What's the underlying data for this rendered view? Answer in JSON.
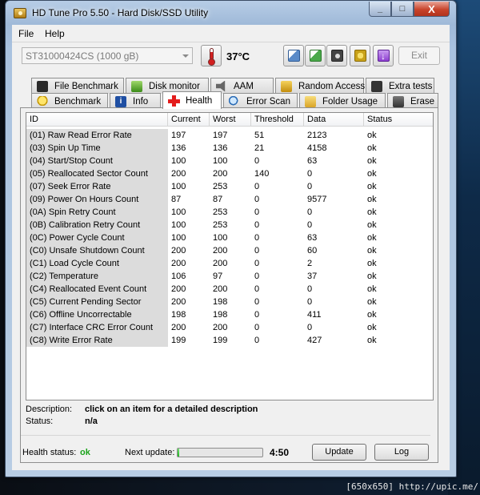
{
  "window": {
    "title": "HD Tune Pro 5.50 - Hard Disk/SSD Utility",
    "caption_buttons": [
      "_",
      "□",
      "X"
    ]
  },
  "menu": {
    "file": "File",
    "help": "Help"
  },
  "toolbar": {
    "drive": "ST31000424CS (1000 gB)",
    "temperature": "37°C",
    "exit_label": "Exit",
    "icons": [
      "copy-text-icon",
      "copy-screenshot-icon",
      "camera-icon",
      "options-icon",
      "save-download-icon"
    ]
  },
  "tabs": {
    "row1": [
      {
        "label": "File Benchmark",
        "icon": "file-benchmark-icon"
      },
      {
        "label": "Disk monitor",
        "icon": "disk-monitor-icon"
      },
      {
        "label": "AAM",
        "icon": "speaker-icon"
      },
      {
        "label": "Random Access",
        "icon": "random-access-icon"
      },
      {
        "label": "Extra tests",
        "icon": "extra-tests-icon"
      }
    ],
    "row2": [
      {
        "label": "Benchmark",
        "icon": "lightbulb-icon"
      },
      {
        "label": "Info",
        "icon": "info-icon"
      },
      {
        "label": "Health",
        "icon": "health-cross-icon",
        "active": true
      },
      {
        "label": "Error Scan",
        "icon": "magnifier-icon"
      },
      {
        "label": "Folder Usage",
        "icon": "folder-icon"
      },
      {
        "label": "Erase",
        "icon": "trash-icon"
      }
    ]
  },
  "table": {
    "headers": [
      "ID",
      "Current",
      "Worst",
      "Threshold",
      "Data",
      "Status"
    ],
    "rows": [
      [
        "(01) Raw Read Error Rate",
        "197",
        "197",
        "51",
        "2123",
        "ok"
      ],
      [
        "(03) Spin Up Time",
        "136",
        "136",
        "21",
        "4158",
        "ok"
      ],
      [
        "(04) Start/Stop Count",
        "100",
        "100",
        "0",
        "63",
        "ok"
      ],
      [
        "(05) Reallocated Sector Count",
        "200",
        "200",
        "140",
        "0",
        "ok"
      ],
      [
        "(07) Seek Error Rate",
        "100",
        "253",
        "0",
        "0",
        "ok"
      ],
      [
        "(09) Power On Hours Count",
        "87",
        "87",
        "0",
        "9577",
        "ok"
      ],
      [
        "(0A) Spin Retry Count",
        "100",
        "253",
        "0",
        "0",
        "ok"
      ],
      [
        "(0B) Calibration Retry Count",
        "100",
        "253",
        "0",
        "0",
        "ok"
      ],
      [
        "(0C) Power Cycle Count",
        "100",
        "100",
        "0",
        "63",
        "ok"
      ],
      [
        "(C0) Unsafe Shutdown Count",
        "200",
        "200",
        "0",
        "60",
        "ok"
      ],
      [
        "(C1) Load Cycle Count",
        "200",
        "200",
        "0",
        "2",
        "ok"
      ],
      [
        "(C2) Temperature",
        "106",
        "97",
        "0",
        "37",
        "ok"
      ],
      [
        "(C4) Reallocated Event Count",
        "200",
        "200",
        "0",
        "0",
        "ok"
      ],
      [
        "(C5) Current Pending Sector",
        "200",
        "198",
        "0",
        "0",
        "ok"
      ],
      [
        "(C6) Offline Uncorrectable",
        "198",
        "198",
        "0",
        "411",
        "ok"
      ],
      [
        "(C7) Interface CRC Error Count",
        "200",
        "200",
        "0",
        "0",
        "ok"
      ],
      [
        "(C8) Write Error Rate",
        "199",
        "199",
        "0",
        "427",
        "ok"
      ]
    ]
  },
  "description": {
    "label": "Description:",
    "value": "click on an item for a detailed description",
    "status_label": "Status:",
    "status_value": "n/a"
  },
  "footer": {
    "health_label": "Health status:",
    "health_value": "ok",
    "health_color": "#1aa31a",
    "next_update_label": "Next update:",
    "next_update_time": "4:50",
    "next_update_progress": 0.02,
    "update_label": "Update",
    "log_label": "Log"
  },
  "watermark": "[650x650] http://upic.me/"
}
